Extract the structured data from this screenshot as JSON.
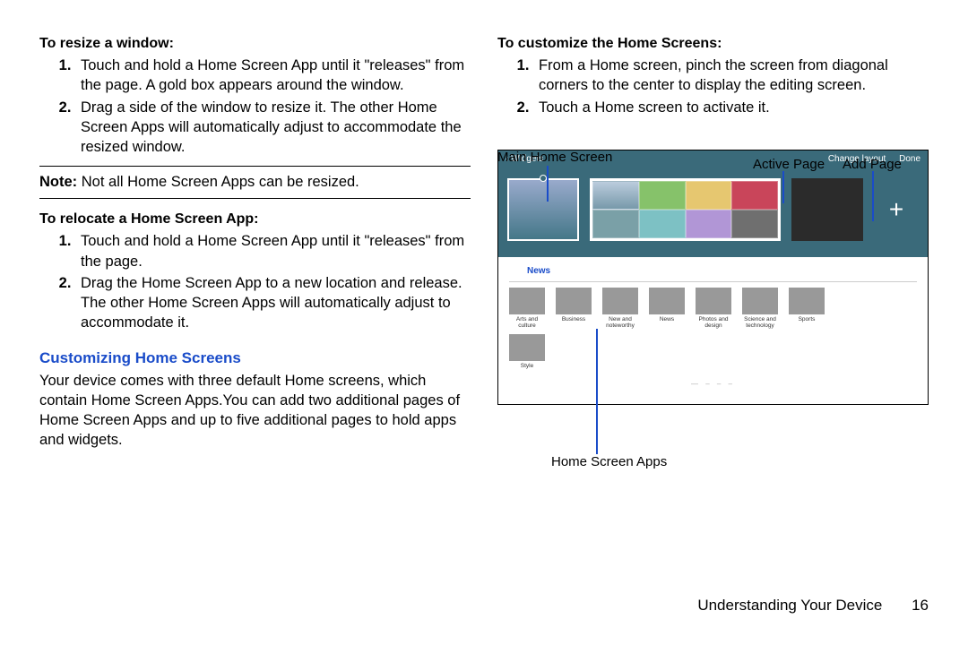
{
  "left": {
    "resize_heading": "To resize a window:",
    "resize_steps": [
      "Touch and hold a Home Screen App until it \"releases\" from the page. A gold box appears around the window.",
      "Drag a side of the window to resize it. The other Home Screen Apps will automatically adjust to accommodate the resized window."
    ],
    "note_label": "Note:",
    "note_text": " Not all Home Screen Apps can be resized.",
    "relocate_heading": "To relocate a Home Screen App:",
    "relocate_steps": [
      "Touch and hold a Home Screen App until it \"releases\" from the page.",
      "Drag the Home Screen App to a new location and release. The other Home Screen Apps will automatically adjust to accommodate it."
    ],
    "custom_title": "Customizing Home Screens",
    "custom_body": "Your device comes with three default Home screens, which contain Home Screen Apps.You can add two additional pages of Home Screen Apps and up to five additional pages to hold apps and widgets."
  },
  "right": {
    "customize_heading": "To customize the Home Screens:",
    "customize_steps": [
      "From a Home screen, pinch the screen from diagonal corners to the center to display the editing screen.",
      "Touch a Home screen to activate it."
    ],
    "ann_main": "Main Home Screen",
    "ann_active": "Active Page",
    "ann_add": "Add Page",
    "ann_apps": "Home Screen Apps",
    "barWidgets": "‹ Widgets",
    "barChange": "Change layout",
    "barDone": "Done",
    "newsTitle": "News",
    "tiles_row1": [
      "Arts and culture",
      "Business",
      "New and noteworthy",
      "News",
      "Photos and design",
      "Science and technology",
      "Sports"
    ],
    "tiles_row2": [
      "Style"
    ]
  },
  "footer": {
    "chapter": "Understanding Your Device",
    "page": "16"
  }
}
